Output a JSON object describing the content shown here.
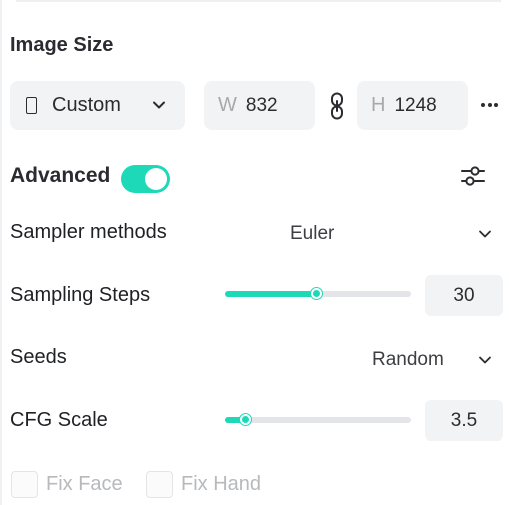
{
  "image_size": {
    "title": "Image Size",
    "ratio_select": {
      "label": "Custom"
    },
    "width": {
      "prefix": "W",
      "value": "832"
    },
    "height": {
      "prefix": "H",
      "value": "1248"
    }
  },
  "advanced": {
    "label": "Advanced",
    "toggle_on": true
  },
  "sampler": {
    "label": "Sampler methods",
    "value": "Euler"
  },
  "steps": {
    "label": "Sampling Steps",
    "value": "30",
    "slider_fraction": 0.49
  },
  "seeds": {
    "label": "Seeds",
    "value": "Random"
  },
  "cfg": {
    "label": "CFG Scale",
    "value": "3.5",
    "slider_fraction": 0.11
  },
  "options": {
    "fix_face": "Fix Face",
    "fix_hand": "Fix Hand"
  },
  "colors": {
    "accent": "#1ed9b8",
    "field_bg": "#f2f3f5",
    "muted_text": "#b7b9bd"
  }
}
